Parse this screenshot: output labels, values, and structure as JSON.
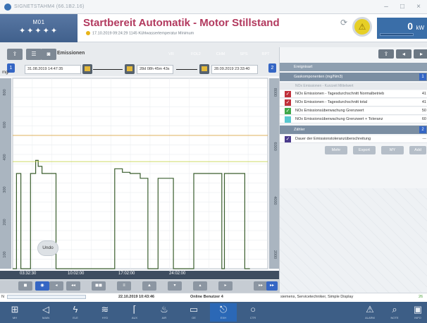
{
  "window": {
    "title": "SIGNETSTAHM4 (66.1B2.16)",
    "min": "–",
    "max": "□",
    "close": "×"
  },
  "header": {
    "machine_code": "M01",
    "machine_stars": "✦✦✦✦✦",
    "status_title": "Startbereit Automatik - Motor Stillstand",
    "alarm_text": "17.10.2019 09:24:29 1145 Kühlwasser­temperatur Minimum",
    "refresh_icon": "refresh-icon",
    "warning_icon": "warning-icon",
    "power_value": "0",
    "power_unit": "kW",
    "power_level": 0
  },
  "toolbar": {
    "section_label": "Emissionen",
    "chips": [
      {
        "label": "VR",
        "color": "#e8a23a"
      },
      {
        "label": "FOL2",
        "color": "#6bbde0"
      },
      {
        "label": "CHM",
        "color": "#e8a23a"
      },
      {
        "label": "SPS",
        "color": "#c469c9"
      },
      {
        "label": "RPT",
        "color": "#4a88d6"
      }
    ]
  },
  "controls": {
    "left_badge": "1",
    "start_date": "31.08.2019 14:47:35",
    "duration": "28d 08h 45m 43s",
    "end_date": "28.09.2019 23:33:40",
    "right_badge": "2",
    "y_unit": "mg/"
  },
  "chart_data": {
    "type": "line",
    "title": "",
    "xlabel": "",
    "ylabel": "mg/",
    "x_ticks": [
      "03:32:30",
      "10:02:00",
      "17:02:00",
      "24:02:00"
    ],
    "y_ticks_left": [
      "800",
      "600",
      "400",
      "300",
      "200",
      "100"
    ],
    "y_ticks_right": [
      "8000",
      "6000",
      "4000",
      "2000"
    ],
    "series": [
      {
        "x": [
          0,
          1.5,
          1.5,
          3.2,
          3.2,
          7,
          7,
          9,
          9,
          10,
          10,
          11.5,
          11.5,
          17,
          17,
          20,
          20,
          24,
          24,
          27,
          27,
          33,
          33,
          38,
          38,
          40,
          40,
          43,
          43,
          46,
          46,
          50,
          50,
          53,
          53,
          57,
          57,
          63,
          63,
          70,
          70,
          71,
          71,
          82,
          82,
          83,
          83,
          91,
          91,
          93,
          93
        ],
        "y": [
          0,
          0,
          400,
          400,
          0,
          0,
          400,
          400,
          455,
          455,
          430,
          430,
          400,
          400,
          0,
          0,
          0,
          0,
          0,
          0,
          0,
          0,
          0,
          0,
          0,
          0,
          420,
          420,
          405,
          405,
          400,
          400,
          380,
          380,
          0,
          0,
          380,
          380,
          0,
          0,
          0,
          0,
          400,
          400,
          0,
          0,
          400,
          400,
          0,
          0,
          0
        ]
      },
      {
        "x": [
          0,
          100
        ],
        "y": [
          560,
          560
        ]
      },
      {
        "x": [
          0,
          100
        ],
        "y": [
          450,
          450
        ]
      }
    ],
    "series_colors": [
      "#3a5e2e",
      "#d99a2a",
      "#bfcf35"
    ],
    "xlim": [
      0,
      100
    ],
    "ylim": [
      0,
      800
    ]
  },
  "undo": {
    "label": "Undo"
  },
  "nav": {
    "buttons": [
      "◼",
      "◉",
      "◂",
      "◂◂",
      "◼◼",
      "≡",
      "▲",
      "▾",
      "▴",
      "▸",
      "▸▸",
      "⟲",
      "◂",
      "▸▸"
    ]
  },
  "panel": {
    "header_row": "Ereignisart",
    "section1": "Gaskomponenten (mg/Nm3)",
    "section1_num": "1",
    "subrow": "NOx Emissionen - Kurzzeit Mittelwert",
    "rows": [
      {
        "label": "NOx Emissionen - Tagesdurchschnitt Normalbetrieb",
        "value": "41",
        "color": "#c0303a"
      },
      {
        "label": "NOx Emissionen - Tagesdurchschnitt total",
        "value": "41",
        "color": "#c0303a"
      },
      {
        "label": "NOx Emissionsüberwachung Grenzwert",
        "value": "50",
        "color": "#3fa84a"
      },
      {
        "label": "NOx Emissionsüberwachung Grenzwert + Toleranz",
        "value": "60",
        "color": "#58c8d0"
      }
    ],
    "section2": "Zähler",
    "section2_num": "2",
    "row_last": {
      "label": "Dauer der Emissionstoleranzüberschreitung",
      "value": "---",
      "color": "#4a3a8c"
    },
    "actions": [
      "Mehr",
      "Export",
      "MY",
      "Add"
    ]
  },
  "statusbar": {
    "left_marker": "N",
    "datetime": "22.10.2019 10:43:46",
    "users": "Online Benutzer 4",
    "user_info": "siemens, Servicetechniker, Simple Display",
    "right_marker": "26"
  },
  "bottom": {
    "buttons": [
      {
        "icon": "⊞",
        "label": "MH"
      },
      {
        "icon": "◁",
        "label": "MAIN"
      },
      {
        "icon": "ϟ",
        "label": "ELE"
      },
      {
        "icon": "≋",
        "label": "HYD"
      },
      {
        "icon": "⌈",
        "label": "AUX"
      },
      {
        "icon": "♨",
        "label": "AIR"
      },
      {
        "icon": "▭",
        "label": "OE"
      },
      {
        "icon": "⎋",
        "label": "EXH"
      },
      {
        "icon": "○",
        "label": "CTR"
      },
      {
        "icon": "⚠",
        "label": "ALARM"
      },
      {
        "icon": "⌕",
        "label": "NOTE"
      },
      {
        "icon": "▣",
        "label": "INFO"
      }
    ],
    "active_index": 7
  }
}
